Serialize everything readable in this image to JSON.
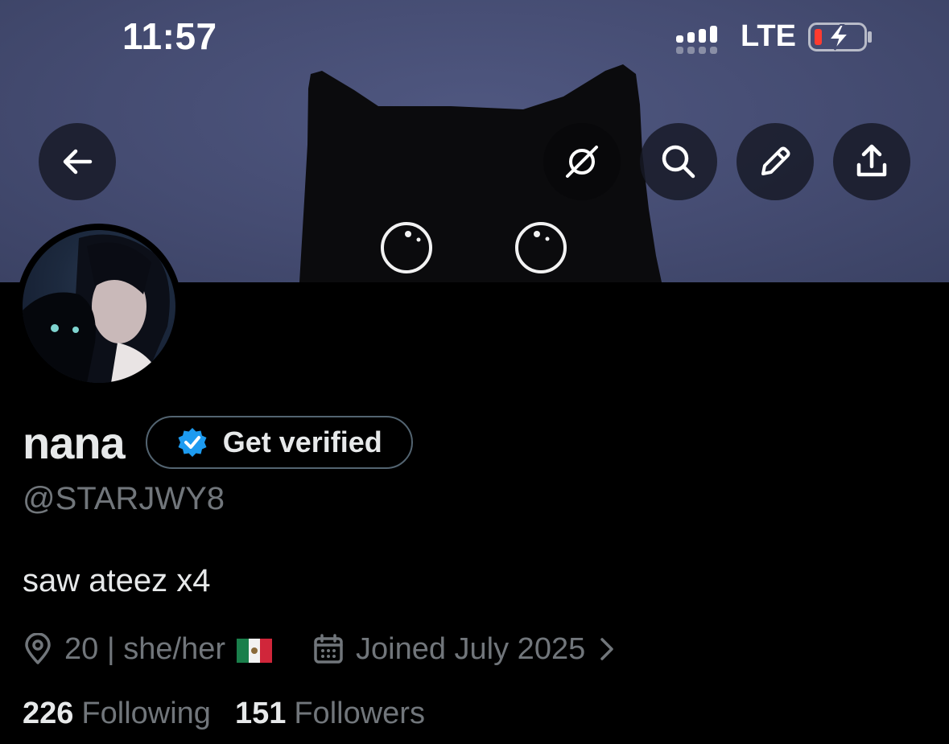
{
  "status_bar": {
    "time": "11:57",
    "network": "LTE"
  },
  "banner": {
    "icons": [
      "back-arrow-icon",
      "grok-icon",
      "search-icon",
      "pencil-icon",
      "share-icon"
    ]
  },
  "profile": {
    "display_name": "nana",
    "verify_button_label": "Get verified",
    "handle": "@STARJWY8",
    "bio": "saw ateez x4",
    "location": "20 | she/her",
    "joined": "Joined July 2025",
    "following_count": "226",
    "following_label": "Following",
    "followers_count": "151",
    "followers_label": "Followers"
  },
  "colors": {
    "verified_blue": "#1d9bf0",
    "muted_text": "#71767b",
    "text": "#e7e9ea",
    "battery_low": "#ff3b30"
  }
}
